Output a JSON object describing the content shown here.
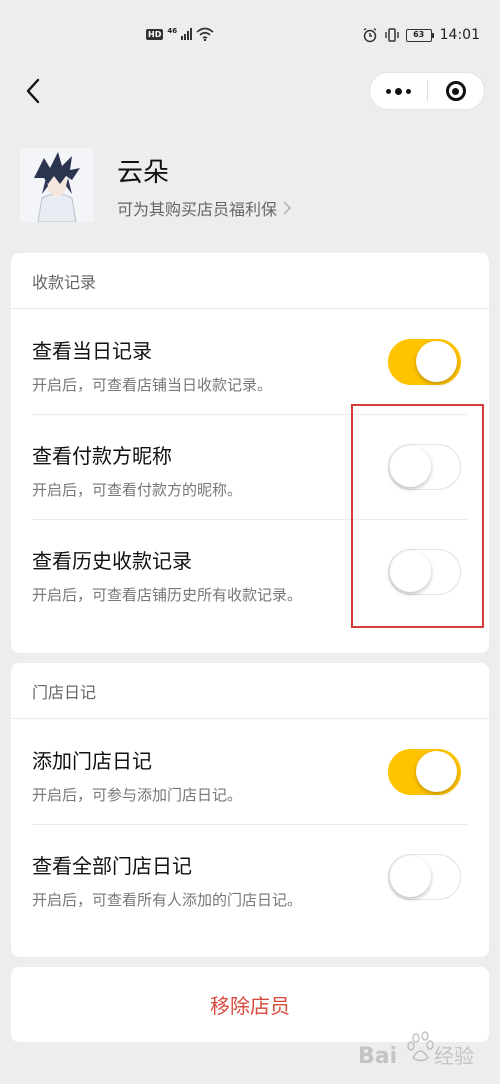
{
  "status_bar": {
    "hd": "HD",
    "network": "46",
    "battery": "63",
    "time": "14:01"
  },
  "nav": {
    "back_icon": "chevron-left-icon",
    "more_icon": "more-dots-icon",
    "close_icon": "target-close-icon"
  },
  "profile": {
    "name": "云朵",
    "subtitle": "可为其购买店员福利保"
  },
  "sections": [
    {
      "header": "收款记录",
      "rows": [
        {
          "title": "查看当日记录",
          "desc": "开启后，可查看店铺当日收款记录。",
          "on": true
        },
        {
          "title": "查看付款方昵称",
          "desc": "开启后，可查看付款方的昵称。",
          "on": false
        },
        {
          "title": "查看历史收款记录",
          "desc": "开启后，可查看店铺历史所有收款记录。",
          "on": false
        }
      ]
    },
    {
      "header": "门店日记",
      "rows": [
        {
          "title": "添加门店日记",
          "desc": "开启后，可参与添加门店日记。",
          "on": true
        },
        {
          "title": "查看全部门店日记",
          "desc": "开启后，可查看所有人添加的门店日记。",
          "on": false
        }
      ]
    }
  ],
  "remove_button": "移除店员",
  "watermark": "Bai 经验",
  "colors": {
    "accent": "#ffc300",
    "danger": "#d84a3d",
    "highlight_box": "#d93a3a",
    "background": "#ededed"
  }
}
